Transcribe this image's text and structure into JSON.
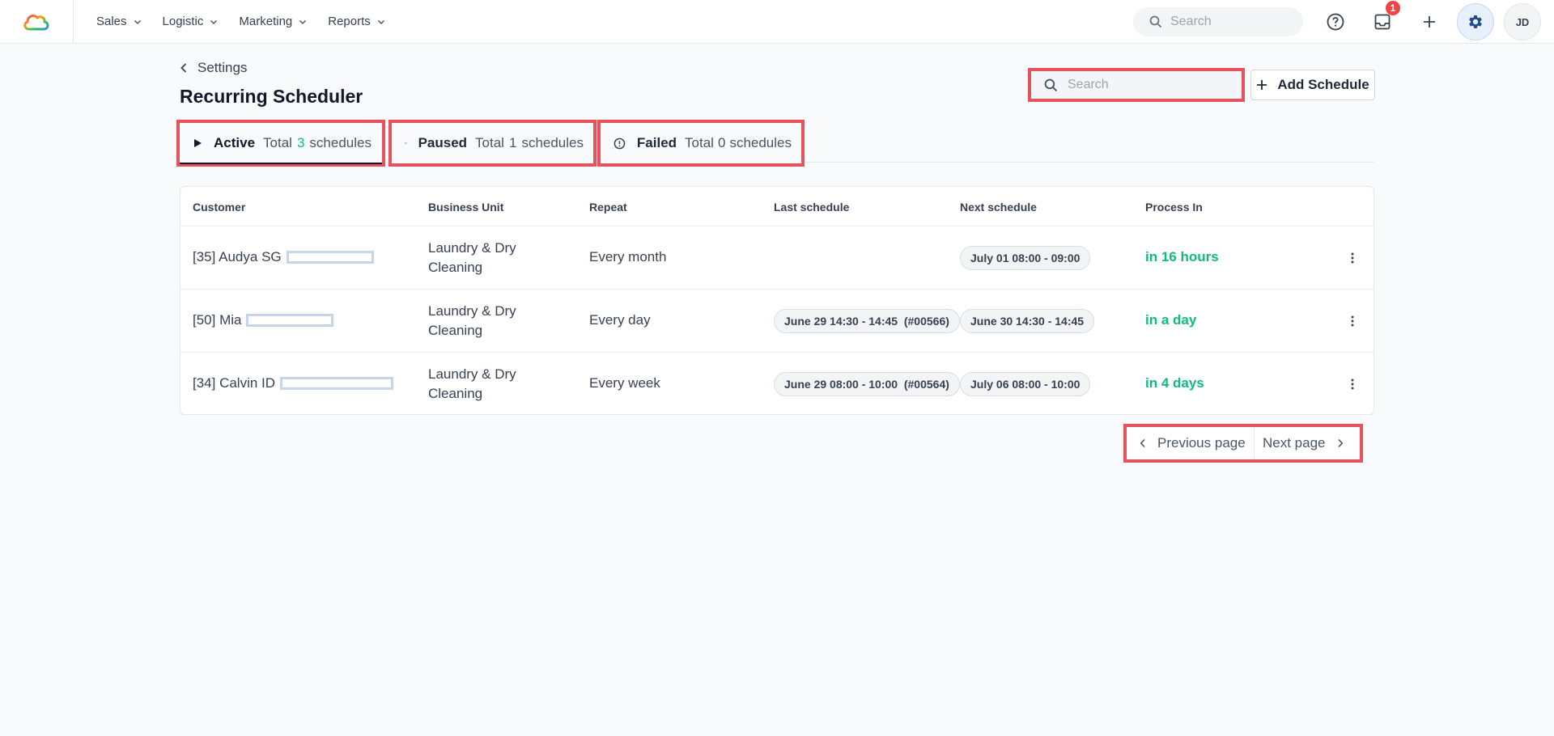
{
  "nav": {
    "menu": [
      {
        "label": "Sales"
      },
      {
        "label": "Logistic"
      },
      {
        "label": "Marketing"
      },
      {
        "label": "Reports"
      }
    ],
    "search_placeholder": "Search",
    "notification_count": "1",
    "avatar_initials": "JD"
  },
  "header": {
    "breadcrumb": "Settings",
    "title": "Recurring Scheduler",
    "search_placeholder": "Search",
    "add_button": "Add Schedule"
  },
  "tabs": [
    {
      "name": "Active",
      "total_label": "Total",
      "count": "3",
      "suffix": "schedules",
      "icon": "play-icon"
    },
    {
      "name": "Paused",
      "total_label": "Total",
      "count": "1",
      "suffix": "schedules",
      "icon": "ban-icon"
    },
    {
      "name": "Failed",
      "total_label": "Total",
      "count": "0",
      "suffix": "schedules",
      "icon": "alert-circle-icon"
    }
  ],
  "table": {
    "columns": [
      "Customer",
      "Business Unit",
      "Repeat",
      "Last schedule",
      "Next schedule",
      "Process In"
    ],
    "rows": [
      {
        "customer": "[35] Audya SG",
        "business_unit": "Laundry & Dry Cleaning",
        "repeat": "Every month",
        "last_schedule": "",
        "next_schedule": "July 01 08:00 - 09:00",
        "process_in": "in 16 hours"
      },
      {
        "customer": "[50] Mia",
        "business_unit": "Laundry & Dry Cleaning",
        "repeat": "Every day",
        "last_schedule": "June 29 14:30 - 14:45  (#00566)",
        "next_schedule": "June 30 14:30 - 14:45",
        "process_in": "in a day"
      },
      {
        "customer": "[34] Calvin ID",
        "business_unit": "Laundry & Dry Cleaning",
        "repeat": "Every week",
        "last_schedule": "June 29 08:00 - 10:00  (#00564)",
        "next_schedule": "July 06 08:00 - 10:00",
        "process_in": "in 4 days"
      }
    ]
  },
  "pagination": {
    "previous": "Previous page",
    "next": "Next page"
  },
  "colors": {
    "accent_green": "#10b981",
    "highlight_red": "#e5535d",
    "settings_blue": "#1d4e89"
  }
}
